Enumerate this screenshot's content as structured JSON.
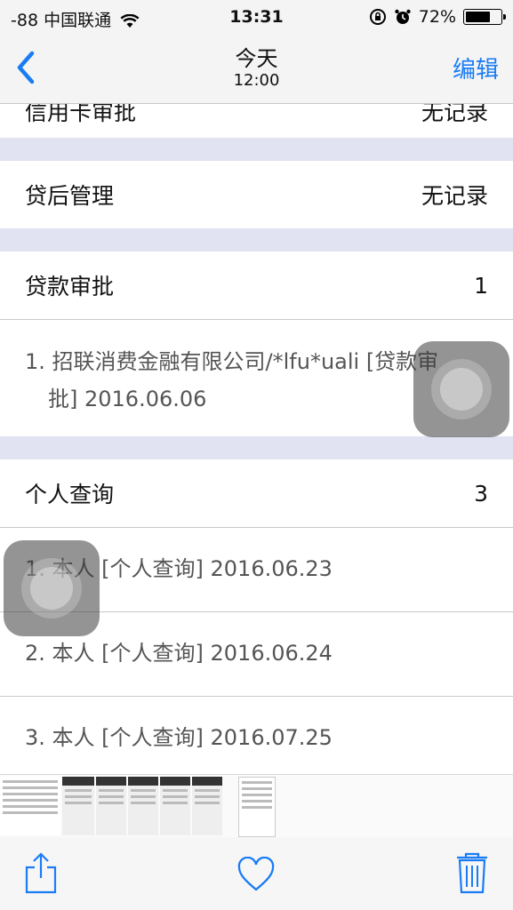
{
  "status": {
    "carrier": "-88 中国联通",
    "time": "13:31",
    "battery": "72%",
    "battery_level": 0.72
  },
  "nav": {
    "title": "今天",
    "subtitle": "12:00",
    "edit_label": "编辑"
  },
  "sections": [
    {
      "title": "信用卡审批",
      "value": "无记录"
    },
    {
      "title": "贷后管理",
      "value": "无记录"
    },
    {
      "title": "贷款审批",
      "value": "1",
      "items": [
        {
          "line1": "1. 招联消费金融有限公司/*lfu*uali [贷款审",
          "line2": "批] 2016.06.06"
        }
      ]
    },
    {
      "title": "个人查询",
      "value": "3",
      "items": [
        "1. 本人 [个人查询] 2016.06.23",
        "2. 本人 [个人查询] 2016.06.24",
        "3. 本人 [个人查询] 2016.07.25"
      ]
    }
  ],
  "colors": {
    "accent": "#1a7cf5",
    "section_gap": "#e1e2f2"
  },
  "icons": {
    "back": "chevron-left-icon",
    "share": "share-icon",
    "favorite": "heart-icon",
    "delete": "trash-icon"
  }
}
